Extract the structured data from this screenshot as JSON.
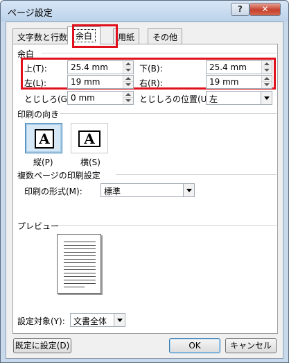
{
  "window": {
    "title": "ページ設定",
    "help_label": "?",
    "close_label": "✕"
  },
  "tabs": [
    {
      "label": "文字数と行数",
      "active": false
    },
    {
      "label": "余白",
      "active": true
    },
    {
      "label": "用紙",
      "active": false
    },
    {
      "label": "その他",
      "active": false
    }
  ],
  "margins": {
    "section_label": "余白",
    "top": {
      "label": "上(T):",
      "value": "25.4 mm"
    },
    "bottom": {
      "label": "下(B):",
      "value": "25.4 mm"
    },
    "left": {
      "label": "左(L):",
      "value": "19 mm"
    },
    "right": {
      "label": "右(R):",
      "value": "19 mm"
    },
    "gutter": {
      "label": "とじしろ(G):",
      "value": "0 mm"
    },
    "gutter_position": {
      "label": "とじしろの位置(U):",
      "value": "左"
    }
  },
  "orientation": {
    "section_label": "印刷の向き",
    "portrait": {
      "label": "縦(P)",
      "glyph": "A",
      "selected": true
    },
    "landscape": {
      "label": "横(S)",
      "glyph": "A",
      "selected": false
    }
  },
  "pages": {
    "section_label": "複数ページの印刷設定",
    "format_label": "印刷の形式(M):",
    "format_value": "標準"
  },
  "preview": {
    "section_label": "プレビュー"
  },
  "apply_to": {
    "label": "設定対象(Y):",
    "value": "文書全体"
  },
  "buttons": {
    "default_label": "既定に設定(D)",
    "ok_label": "OK",
    "cancel_label": "キャンセル"
  },
  "colors": {
    "highlight": "#e0101c",
    "title_bar": "#c9d9ec",
    "close_button": "#c6402c"
  }
}
